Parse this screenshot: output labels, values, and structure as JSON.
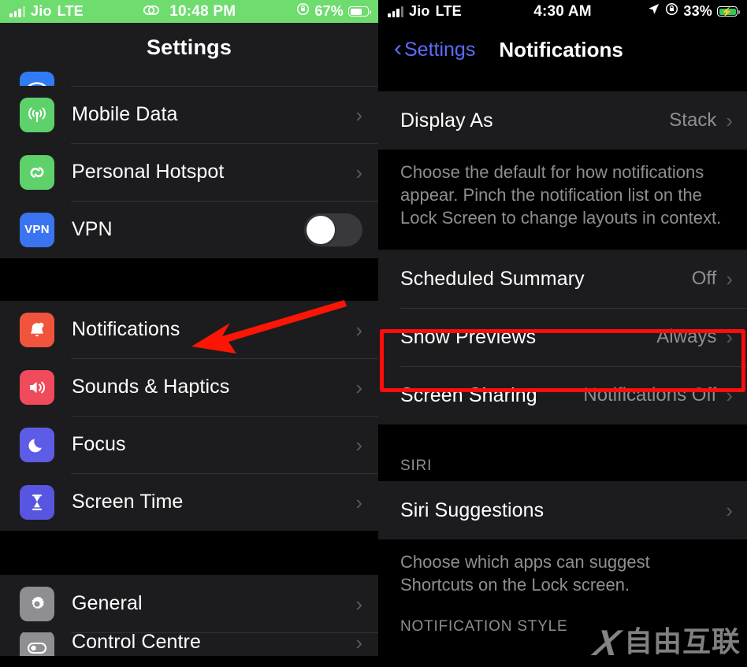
{
  "left_phone": {
    "status_bar": {
      "carrier": "Jio",
      "network": "LTE",
      "time": "10:48 PM",
      "battery_percent": "67%",
      "signal_icon": "signal-bars-icon",
      "airplay_icon": "screen-mirroring-icon",
      "rotation_lock_icon": "rotation-lock-icon",
      "battery_icon": "battery-icon"
    },
    "nav": {
      "title": "Settings"
    },
    "groups": [
      {
        "id": "connectivity",
        "rows": [
          {
            "label": "",
            "icon": "wifi-icon",
            "icon_color": "#2f7cf6",
            "accessory": "chevron",
            "clipped": "top"
          },
          {
            "label": "Mobile Data",
            "icon": "mobile-data-icon",
            "icon_color": "#5ed16a",
            "accessory": "chevron"
          },
          {
            "label": "Personal Hotspot",
            "icon": "personal-hotspot-icon",
            "icon_color": "#5ed16a",
            "accessory": "chevron"
          },
          {
            "label": "VPN",
            "icon": "vpn-icon",
            "icon_color": "#3b74f0",
            "accessory": "toggle",
            "toggle_on": false
          }
        ]
      },
      {
        "id": "notifications-group",
        "rows": [
          {
            "label": "Notifications",
            "icon": "bell-icon",
            "icon_color": "#f0543c",
            "accessory": "chevron"
          },
          {
            "label": "Sounds & Haptics",
            "icon": "speaker-icon",
            "icon_color": "#ef4b5c",
            "accessory": "chevron"
          },
          {
            "label": "Focus",
            "icon": "moon-icon",
            "icon_color": "#5d5ce6",
            "accessory": "chevron"
          },
          {
            "label": "Screen Time",
            "icon": "hourglass-icon",
            "icon_color": "#5856e0",
            "accessory": "chevron"
          }
        ]
      },
      {
        "id": "system-group",
        "rows": [
          {
            "label": "General",
            "icon": "gear-icon",
            "icon_color": "#8e8e93",
            "accessory": "chevron"
          },
          {
            "label": "Control Centre",
            "icon": "control-centre-icon",
            "icon_color": "#8e8e93",
            "accessory": "chevron",
            "clipped": "bottom"
          }
        ]
      }
    ]
  },
  "right_phone": {
    "status_bar": {
      "carrier": "Jio",
      "network": "LTE",
      "time": "4:30 AM",
      "battery_percent": "33%",
      "location_icon": "location-arrow-icon",
      "rotation_lock_icon": "rotation-lock-icon",
      "battery_icon": "battery-charging-icon"
    },
    "nav": {
      "back_label": "Settings",
      "title": "Notifications",
      "back_icon": "chevron-left-icon"
    },
    "rows": {
      "display_as": {
        "label": "Display As",
        "value": "Stack"
      },
      "display_as_footnote": "Choose the default for how notifications appear. Pinch the notification list on the Lock Screen to change layouts in context.",
      "scheduled_summary": {
        "label": "Scheduled Summary",
        "value": "Off"
      },
      "show_previews": {
        "label": "Show Previews",
        "value": "Always"
      },
      "screen_sharing": {
        "label": "Screen Sharing",
        "value": "Notifications Off"
      },
      "siri_header": "SIRI",
      "siri_suggestions": {
        "label": "Siri Suggestions",
        "value": ""
      },
      "siri_footnote": "Choose which apps can suggest Shortcuts on the Lock screen.",
      "notification_style_header": "NOTIFICATION STYLE"
    }
  },
  "annotations": {
    "arrow_color": "#fb1505",
    "highlight_color": "#ff0d0d",
    "highlight_target": "show-previews-row",
    "arrow_target": "notifications-row"
  },
  "watermark": {
    "mark": "X",
    "text": "自由互联"
  },
  "colors": {
    "row_background": "#1c1c1e",
    "page_background": "#000000",
    "separator": "#323236",
    "secondary_text": "#8e8e93",
    "accent_blue": "#5b6cf9",
    "status_green": "#6fdc6f"
  }
}
